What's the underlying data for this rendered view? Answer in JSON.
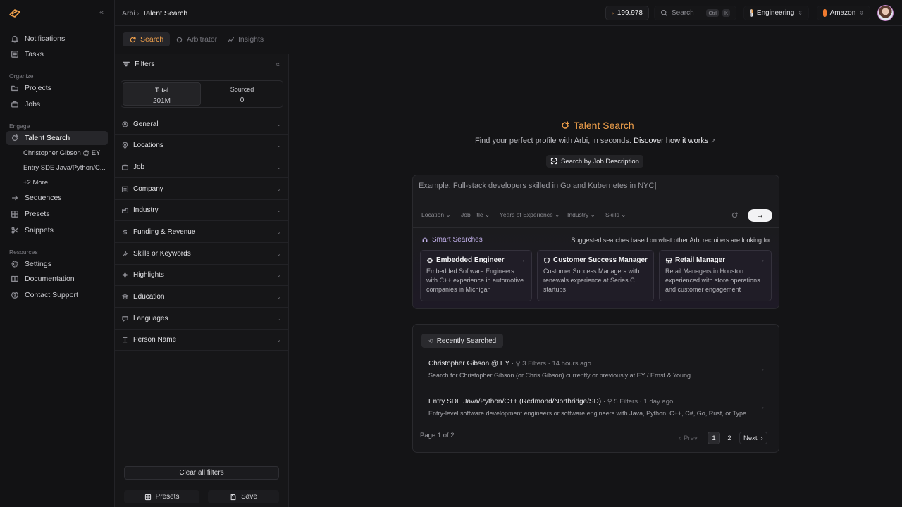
{
  "sidebar": {
    "top_items": [
      {
        "label": "Notifications",
        "icon": "bell-icon"
      },
      {
        "label": "Tasks",
        "icon": "tasks-icon"
      }
    ],
    "sections": {
      "organize": "Organize",
      "engage": "Engage",
      "resources": "Resources"
    },
    "organize_items": [
      {
        "label": "Projects",
        "icon": "folder-icon"
      },
      {
        "label": "Jobs",
        "icon": "briefcase-icon"
      }
    ],
    "engage_items": [
      {
        "label": "Talent Search",
        "icon": "search-spark-icon"
      },
      {
        "label": "Sequences",
        "icon": "sequence-icon"
      },
      {
        "label": "Presets",
        "icon": "grid-icon"
      },
      {
        "label": "Snippets",
        "icon": "scissors-icon"
      }
    ],
    "talent_sub": [
      "Christopher Gibson @ EY",
      "Entry SDE Java/Python/C...",
      "+2 More"
    ],
    "resource_items": [
      {
        "label": "Settings",
        "icon": "gear-icon"
      },
      {
        "label": "Documentation",
        "icon": "book-icon"
      },
      {
        "label": "Contact Support",
        "icon": "help-icon"
      }
    ]
  },
  "topbar": {
    "breadcrumb": [
      "Arbi",
      "Talent Search"
    ],
    "credits": "199.978",
    "search_placeholder": "Search",
    "shortcut": [
      "Ctrl",
      "K"
    ],
    "workspace": "Engineering",
    "company": "Amazon"
  },
  "tabs": [
    {
      "label": "Search",
      "active": true
    },
    {
      "label": "Arbitrator",
      "active": false
    },
    {
      "label": "Insights",
      "active": false
    }
  ],
  "filters": {
    "title": "Filters",
    "stats": [
      {
        "label": "Total",
        "value": "201M"
      },
      {
        "label": "Sourced",
        "value": "0"
      }
    ],
    "groups": [
      "General",
      "Locations",
      "Job",
      "Company",
      "Industry",
      "Funding & Revenue",
      "Skills or Keywords",
      "Highlights",
      "Education",
      "Languages",
      "Person Name"
    ],
    "clear_label": "Clear all filters",
    "presets_label": "Presets",
    "save_label": "Save"
  },
  "hero": {
    "title": "Talent Search",
    "subtitle": "Find your perfect profile with Arbi, in seconds.",
    "link": "Discover how it works",
    "jd_button": "Search by Job Description"
  },
  "search": {
    "query": "Example: Full-stack developers skilled in Go and Kubernetes in NYC",
    "chips": [
      "Location",
      "Job Title",
      "Years of Experience",
      "Industry",
      "Skills"
    ],
    "smart_title": "Smart Searches",
    "smart_note": "Suggested searches based on what other Arbi recruiters are looking for",
    "smart_cards": [
      {
        "title": "Embedded Engineer",
        "desc": "Embedded Software Engineers with C++ experience in automotive companies in Michigan"
      },
      {
        "title": "Customer Success Manager",
        "desc": "Customer Success Managers with renewals experience at Series C startups"
      },
      {
        "title": "Retail Manager",
        "desc": "Retail Managers in Houston experienced with store operations and customer engagement"
      }
    ]
  },
  "recent": {
    "title": "Recently Searched",
    "rows": [
      {
        "title": "Christopher Gibson @ EY",
        "filters": "3 Filters",
        "time": "14 hours ago",
        "desc": "Search for Christopher Gibson (or Chris Gibson) currently or previously at EY / Ernst & Young."
      },
      {
        "title": "Entry SDE Java/Python/C++ (Redmond/Northridge/SD)",
        "filters": "5 Filters",
        "time": "1 day ago",
        "desc": "Entry-level software development engineers or software engineers with Java, Python, C++, C#, Go, Rust, or Type..."
      }
    ],
    "page_info": "Page 1 of 2",
    "prev": "Prev",
    "next": "Next",
    "pages": [
      "1",
      "2"
    ]
  }
}
